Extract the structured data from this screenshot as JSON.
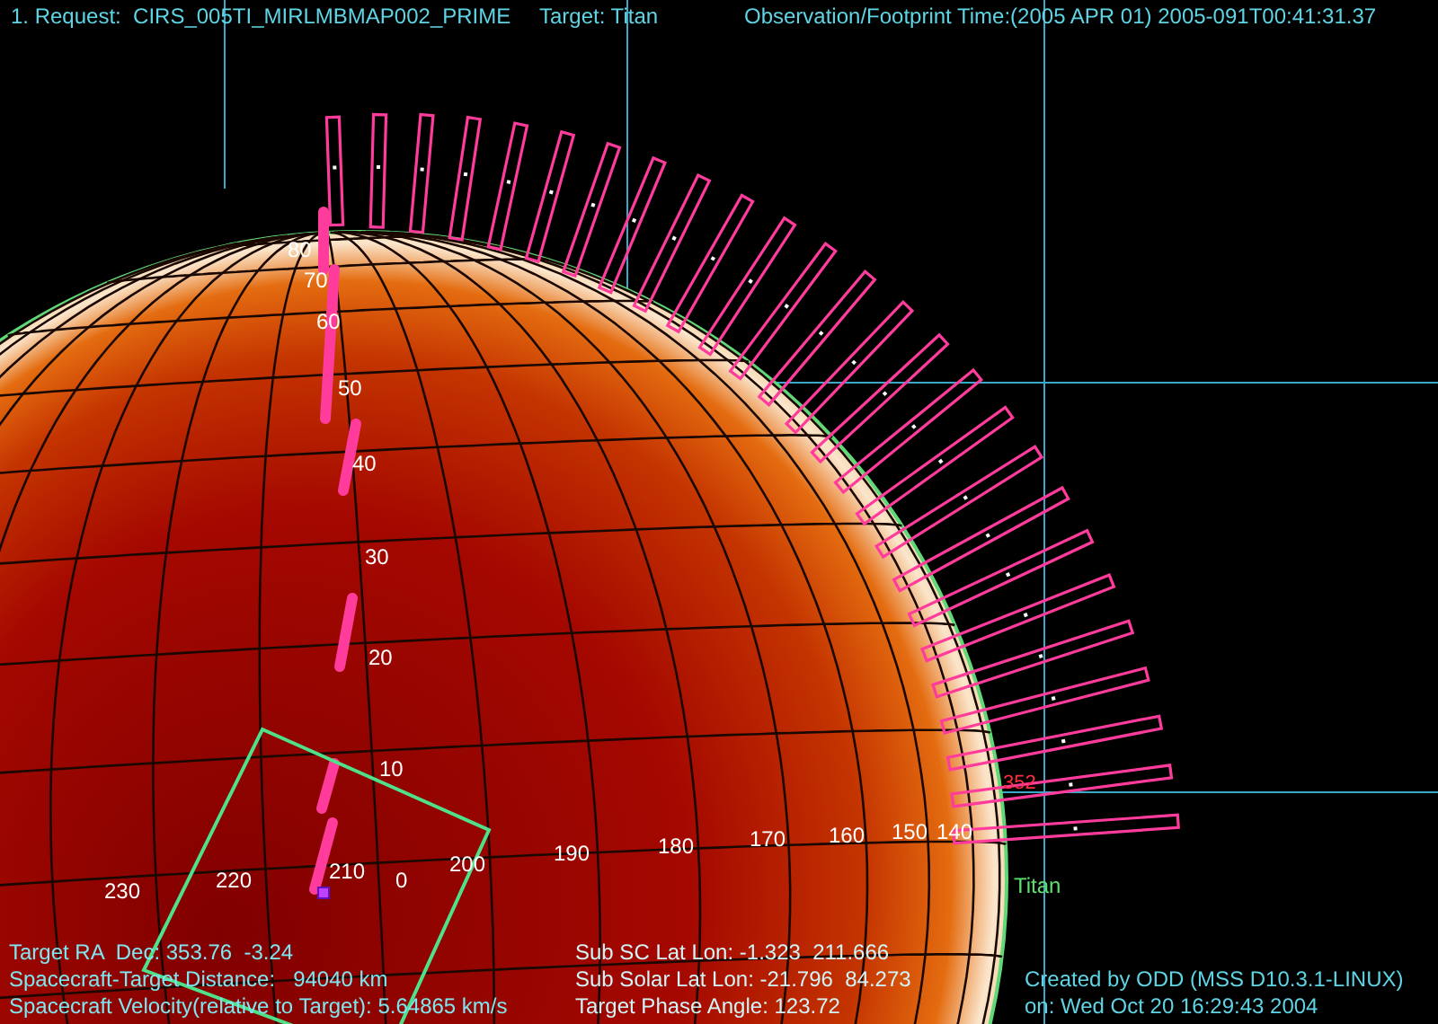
{
  "header": {
    "request": "1. Request:  CIRS_005TI_MIRLMBMAP002_PRIME",
    "target": "Target: Titan",
    "time": "Observation/Footprint Time:(2005 APR 01) 2005-091T00:41:31.37"
  },
  "latitude_labels": [
    "80",
    "70",
    "60",
    "50",
    "40",
    "30",
    "20",
    "10",
    "0"
  ],
  "longitude_labels": [
    "230",
    "220",
    "210",
    "200",
    "190",
    "180",
    "170",
    "160",
    "150",
    "140"
  ],
  "marker_label": "352",
  "target_label": "Titan",
  "info_left": [
    "Target RA  Dec: 353.76  -3.24",
    "Spacecraft-Target Distance:   94040 km",
    "Spacecraft Velocity(relative to Target): 5.64865 km/s"
  ],
  "info_middle": [
    "Sub SC Lat Lon: -1.323  211.666",
    "Sub Solar Lat Lon: -21.796  84.273",
    "Target Phase Angle: 123.72"
  ],
  "credits": [
    "Created by ODD (MSS D10.3.1-LINUX)",
    "on: Wed Oct 20 16:29:43 2004"
  ]
}
